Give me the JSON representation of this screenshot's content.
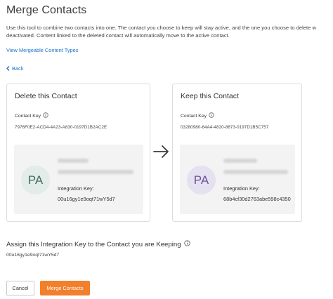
{
  "page": {
    "title": "Merge Contacts",
    "description_line1": "Use this tool to combine two contacts into one. The contact you choose to keep will stay active, and the one you choose to delete w",
    "description_line2": "deactivated. Content linked to the deleted contact will automatically move to the active contact.",
    "view_mergeable_link": "View Mergeable Content Types",
    "back_link": "Back"
  },
  "delete_card": {
    "title": "Delete this Contact",
    "contact_key_label": "Contact Key",
    "contact_key_value": "7976F0E2-ACD4-4A23-A830-0197D1B2AC2E",
    "avatar_initials": "PA",
    "integration_key_label": "Integration Key:",
    "integration_key_value": "00u16gy1e9oqt71wY5d7"
  },
  "keep_card": {
    "title": "Keep this Contact",
    "contact_key_label": "Contact Key",
    "contact_key_value": "03280980-64A4-4820-8673-0197D1B5C757",
    "avatar_initials": "PA",
    "integration_key_label": "Integration Key:",
    "integration_key_value": "68b4cf30d2763abe598c4350"
  },
  "assign": {
    "title": "Assign this Integration Key to the Contact you are Keeping",
    "value": "00u16gy1e9oqt71wY5d7"
  },
  "actions": {
    "cancel_label": "Cancel",
    "merge_label": "Merge Contacts"
  },
  "colors": {
    "link": "#1a73c8",
    "primary_button": "#f27f2c",
    "delete_avatar_bg": "#e2ece8",
    "keep_avatar_bg": "#e6e1f1"
  },
  "icons": {
    "info": "info-circle-icon",
    "back": "chevron-left-icon",
    "arrow": "arrow-right-icon"
  }
}
